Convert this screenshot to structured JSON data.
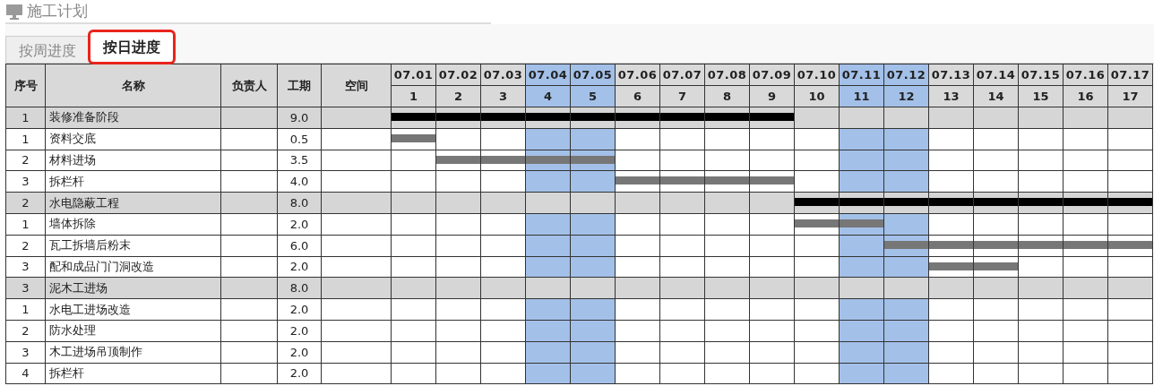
{
  "title": "施工计划",
  "tabs": [
    {
      "label": "按周进度",
      "selected": false,
      "highlighted": false
    },
    {
      "label": "按日进度",
      "selected": true,
      "highlighted": true
    }
  ],
  "columns": [
    "序号",
    "名称",
    "负责人",
    "工期",
    "空间"
  ],
  "days": [
    {
      "date": "07.01",
      "day": "1",
      "weekend": false
    },
    {
      "date": "07.02",
      "day": "2",
      "weekend": false
    },
    {
      "date": "07.03",
      "day": "3",
      "weekend": false
    },
    {
      "date": "07.04",
      "day": "4",
      "weekend": true
    },
    {
      "date": "07.05",
      "day": "5",
      "weekend": true
    },
    {
      "date": "07.06",
      "day": "6",
      "weekend": false
    },
    {
      "date": "07.07",
      "day": "7",
      "weekend": false
    },
    {
      "date": "07.08",
      "day": "8",
      "weekend": false
    },
    {
      "date": "07.09",
      "day": "9",
      "weekend": false
    },
    {
      "date": "07.10",
      "day": "10",
      "weekend": false
    },
    {
      "date": "07.11",
      "day": "11",
      "weekend": true
    },
    {
      "date": "07.12",
      "day": "12",
      "weekend": true
    },
    {
      "date": "07.13",
      "day": "13",
      "weekend": false
    },
    {
      "date": "07.14",
      "day": "14",
      "weekend": false
    },
    {
      "date": "07.15",
      "day": "15",
      "weekend": false
    },
    {
      "date": "07.16",
      "day": "16",
      "weekend": false
    },
    {
      "date": "07.17",
      "day": "17",
      "weekend": false
    }
  ],
  "rows": [
    {
      "kind": "phase",
      "no": "1",
      "name": "装修准备阶段",
      "duration": "9.0",
      "bar": [
        true,
        true,
        true,
        true,
        true,
        true,
        true,
        true,
        true,
        false,
        false,
        false,
        false,
        false,
        false,
        false,
        false
      ]
    },
    {
      "kind": "task",
      "no": "1",
      "name": "资料交底",
      "duration": "0.5",
      "bar": [
        true,
        false,
        false,
        false,
        false,
        false,
        false,
        false,
        false,
        false,
        false,
        false,
        false,
        false,
        false,
        false,
        false
      ]
    },
    {
      "kind": "task",
      "no": "2",
      "name": "材料进场",
      "duration": "3.5",
      "bar": [
        false,
        true,
        true,
        true,
        true,
        false,
        false,
        false,
        false,
        false,
        false,
        false,
        false,
        false,
        false,
        false,
        false
      ]
    },
    {
      "kind": "task",
      "no": "3",
      "name": "拆栏杆",
      "duration": "4.0",
      "bar": [
        false,
        false,
        false,
        false,
        false,
        true,
        true,
        true,
        true,
        false,
        false,
        false,
        false,
        false,
        false,
        false,
        false
      ]
    },
    {
      "kind": "phase",
      "no": "2",
      "name": "水电隐蔽工程",
      "duration": "8.0",
      "bar": [
        false,
        false,
        false,
        false,
        false,
        false,
        false,
        false,
        false,
        true,
        true,
        true,
        true,
        true,
        true,
        true,
        true
      ]
    },
    {
      "kind": "task",
      "no": "1",
      "name": "墙体拆除",
      "duration": "2.0",
      "bar": [
        false,
        false,
        false,
        false,
        false,
        false,
        false,
        false,
        false,
        true,
        true,
        false,
        false,
        false,
        false,
        false,
        false
      ]
    },
    {
      "kind": "task",
      "no": "2",
      "name": "瓦工拆墙后粉末",
      "duration": "6.0",
      "bar": [
        false,
        false,
        false,
        false,
        false,
        false,
        false,
        false,
        false,
        false,
        false,
        true,
        true,
        true,
        true,
        true,
        true
      ]
    },
    {
      "kind": "task",
      "no": "3",
      "name": "配和成品门门洞改造",
      "duration": "2.0",
      "bar": [
        false,
        false,
        false,
        false,
        false,
        false,
        false,
        false,
        false,
        false,
        false,
        false,
        true,
        true,
        false,
        false,
        false
      ]
    },
    {
      "kind": "phase",
      "no": "3",
      "name": "泥木工进场",
      "duration": "8.0",
      "bar": [
        false,
        false,
        false,
        false,
        false,
        false,
        false,
        false,
        false,
        false,
        false,
        false,
        false,
        false,
        false,
        false,
        false
      ]
    },
    {
      "kind": "task",
      "no": "1",
      "name": "水电工进场改造",
      "duration": "2.0",
      "bar": [
        false,
        false,
        false,
        false,
        false,
        false,
        false,
        false,
        false,
        false,
        false,
        false,
        false,
        false,
        false,
        false,
        false
      ]
    },
    {
      "kind": "task",
      "no": "2",
      "name": "防水处理",
      "duration": "2.0",
      "bar": [
        false,
        false,
        false,
        false,
        false,
        false,
        false,
        false,
        false,
        false,
        false,
        false,
        false,
        false,
        false,
        false,
        false
      ]
    },
    {
      "kind": "task",
      "no": "3",
      "name": "木工进场吊顶制作",
      "duration": "2.0",
      "bar": [
        false,
        false,
        false,
        false,
        false,
        false,
        false,
        false,
        false,
        false,
        false,
        false,
        false,
        false,
        false,
        false,
        false
      ]
    },
    {
      "kind": "task",
      "no": "4",
      "name": "拆栏杆",
      "duration": "2.0",
      "bar": [
        false,
        false,
        false,
        false,
        false,
        false,
        false,
        false,
        false,
        false,
        false,
        false,
        false,
        false,
        false,
        false,
        false
      ]
    }
  ]
}
